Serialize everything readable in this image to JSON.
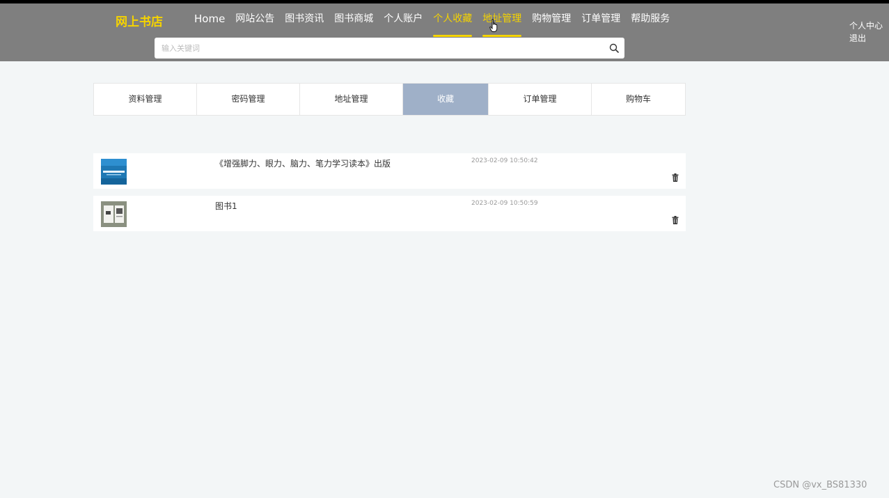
{
  "header": {
    "logo": "网上书店",
    "nav": [
      {
        "label": "Home"
      },
      {
        "label": "网站公告"
      },
      {
        "label": "图书资讯"
      },
      {
        "label": "图书商城"
      },
      {
        "label": "个人账户"
      },
      {
        "label": "个人收藏",
        "active": true
      },
      {
        "label": "地址管理",
        "active": true
      },
      {
        "label": "购物管理"
      },
      {
        "label": "订单管理"
      },
      {
        "label": "帮助服务"
      }
    ],
    "search": {
      "placeholder": "输入关键词",
      "value": ""
    },
    "user_center": "个人中心",
    "logout": "退出",
    "accent_color": "#f5d300",
    "bar_color": "#7f7f7f"
  },
  "tabs": [
    {
      "label": "资料管理"
    },
    {
      "label": "密码管理"
    },
    {
      "label": "地址管理"
    },
    {
      "label": "收藏",
      "active": true
    },
    {
      "label": "订单管理"
    },
    {
      "label": "购物车"
    }
  ],
  "favorites": [
    {
      "title": "《增强脚力、眼力、脑力、笔力学习读本》出版",
      "time": "2023-02-09 10:50:42",
      "icon": "trash-icon"
    },
    {
      "title": "图书1",
      "time": "2023-02-09 10:50:59",
      "icon": "trash-icon"
    }
  ],
  "watermark": "CSDN @vx_BS81330",
  "active_tab_color": "#9fb0c8"
}
